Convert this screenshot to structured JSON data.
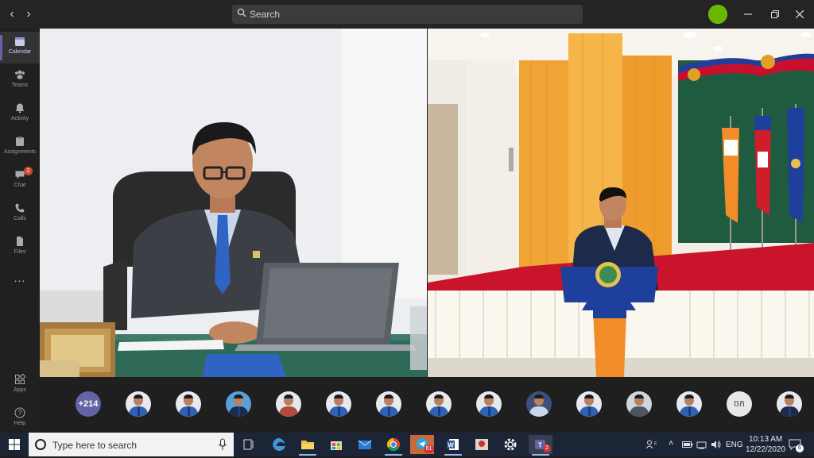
{
  "header": {
    "search_placeholder": "Search",
    "window_controls": [
      "minimize-icon",
      "restore-icon",
      "close-icon"
    ]
  },
  "rail": {
    "items": [
      {
        "label": "Calendar",
        "icon": "calendar-icon",
        "active": true
      },
      {
        "label": "Teams",
        "icon": "teams-icon"
      },
      {
        "label": "Activity",
        "icon": "bell-icon"
      },
      {
        "label": "Assignments",
        "icon": "assignments-icon"
      },
      {
        "label": "Chat",
        "icon": "chat-icon",
        "badge": "2"
      },
      {
        "label": "Calls",
        "icon": "phone-icon"
      },
      {
        "label": "Files",
        "icon": "file-icon"
      },
      {
        "label": "...",
        "icon": "more-icon"
      }
    ],
    "bottom": [
      {
        "label": "Apps",
        "icon": "apps-icon"
      },
      {
        "label": "Help",
        "icon": "help-icon"
      }
    ]
  },
  "participants": {
    "overflow_count": "+214",
    "initials_tile": "ចក"
  },
  "taskbar": {
    "search_placeholder": "Type here to search",
    "telegram_badge": "61",
    "teams_badge": "2",
    "language": "ENG",
    "time": "10:13 AM",
    "date": "12/22/2020",
    "notification_count": "6"
  },
  "colors": {
    "teams_accent": "#6264a7",
    "stage_red": "#c8102e",
    "curtain_gold": "#f2a93b",
    "backdrop_green": "#1f5b3e"
  }
}
